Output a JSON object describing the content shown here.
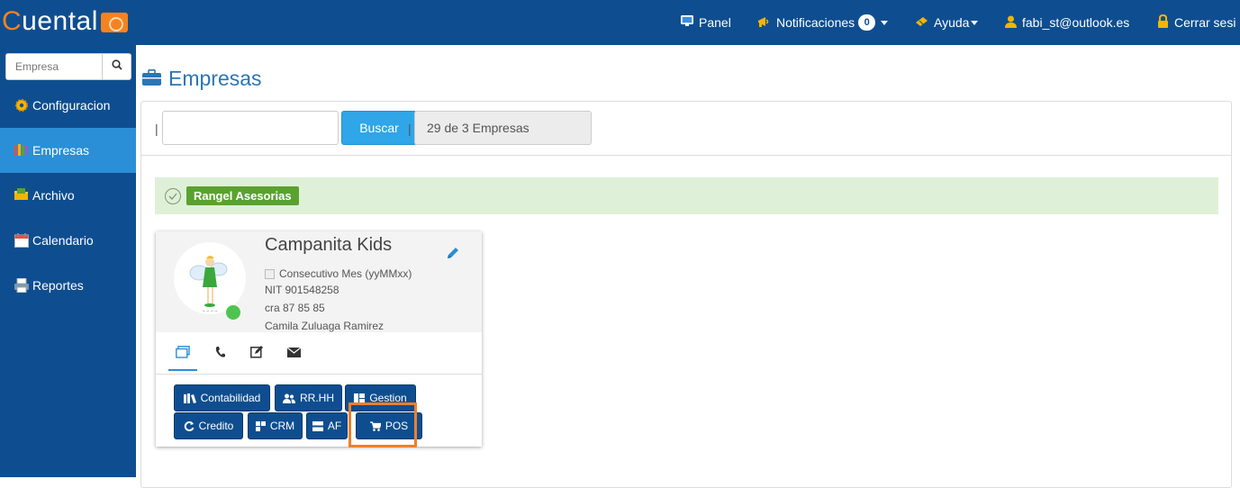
{
  "brand": {
    "name_first": "C",
    "name_rest": "uental"
  },
  "topnav": {
    "panel": "Panel",
    "notifications": "Notificaciones",
    "notifications_count": "0",
    "help": "Ayuda",
    "user_email": "fabi_st@outlook.es",
    "logout": "Cerrar sesi"
  },
  "sidebar": {
    "search_placeholder": "Empresa",
    "items": [
      {
        "label": "Configuracion",
        "icon": "gear-icon"
      },
      {
        "label": "Empresas",
        "icon": "books-icon",
        "active": true
      },
      {
        "label": "Archivo",
        "icon": "folder-icon"
      },
      {
        "label": "Calendario",
        "icon": "calendar-icon"
      },
      {
        "label": "Reportes",
        "icon": "printer-icon"
      }
    ]
  },
  "page": {
    "title": "Empresas"
  },
  "search": {
    "separator": "|",
    "input_value": "",
    "button_label": "Buscar",
    "count_text": "29 de 3 Empresas"
  },
  "group": {
    "label": "Rangel Asesorias"
  },
  "company": {
    "name": "Campanita Kids",
    "consecutive_label": "Consecutivo Mes (yyMMxx)",
    "nit": "NIT 901548258",
    "address": "cra 87 85 85",
    "contact": "Camila Zuluaga Ramirez",
    "tabs": [
      "window-icon",
      "phone-icon",
      "edit-note-icon",
      "envelope-icon"
    ],
    "modules": [
      {
        "label": "Contabilidad",
        "icon": "books-icon"
      },
      {
        "label": "RR.HH",
        "icon": "users-icon"
      },
      {
        "label": "Gestion",
        "icon": "grid-icon"
      },
      {
        "label": "Credito",
        "icon": "refresh-icon"
      },
      {
        "label": "CRM",
        "icon": "blocks-icon"
      },
      {
        "label": "AF",
        "icon": "layers-icon"
      },
      {
        "label": "POS",
        "icon": "cart-icon"
      }
    ]
  },
  "colors": {
    "navbar": "#0e4e90",
    "active": "#2a8fd6",
    "highlight": "#f07f2a",
    "group_bg": "#dff0d8",
    "group_label": "#5aa22f"
  }
}
